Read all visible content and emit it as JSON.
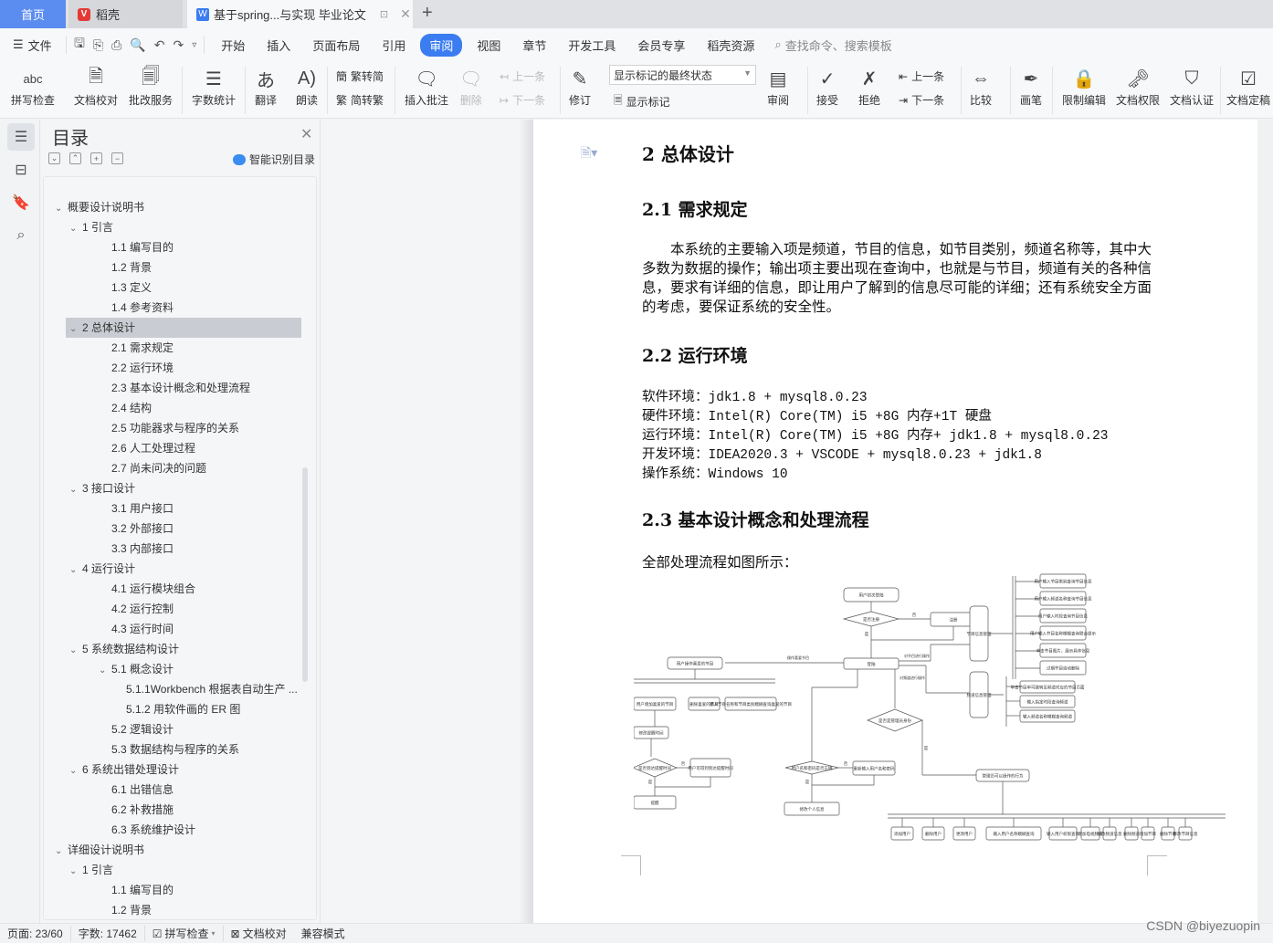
{
  "tabs": {
    "home": "首页",
    "daoke": "稻壳",
    "document": "基于spring...与实现 毕业论文"
  },
  "menubar": {
    "file": "文件",
    "menus": [
      "开始",
      "插入",
      "页面布局",
      "引用",
      "审阅",
      "视图",
      "章节",
      "开发工具",
      "会员专享",
      "稻壳资源"
    ],
    "active_menu": "审阅",
    "search_placeholder": "查找命令、搜索模板"
  },
  "ribbon": {
    "spell_check": "拼写检查",
    "doc_proofread": "文档校对",
    "correction_service": "批改服务",
    "word_count": "字数统计",
    "translate": "翻译",
    "read_aloud": "朗读",
    "trad_to_simp": "繁转简",
    "simp_to_trad": "简转繁",
    "insert_comment": "插入批注",
    "delete": "删除",
    "prev_comment": "上一条",
    "next_comment": "下一条",
    "revise": "修订",
    "markup_state": "显示标记的最终状态",
    "show_markup": "显示标记",
    "review": "审阅",
    "accept": "接受",
    "reject": "拒绝",
    "prev_change": "上一条",
    "next_change": "下一条",
    "compare": "比较",
    "pen": "画笔",
    "restrict_edit": "限制编辑",
    "doc_permission": "文档权限",
    "doc_certify": "文档认证",
    "doc_finalize": "文档定稿"
  },
  "toc": {
    "title": "目录",
    "smart_button": "智能识别目录",
    "items": [
      {
        "label": "概要设计说明书",
        "level": 0,
        "expanded": true
      },
      {
        "label": "1 引言",
        "level": 1,
        "expanded": true
      },
      {
        "label": "1.1 编写目的",
        "level": 2
      },
      {
        "label": "1.2 背景",
        "level": 2
      },
      {
        "label": "1.3 定义",
        "level": 2
      },
      {
        "label": "1.4 参考资料",
        "level": 2
      },
      {
        "label": "2 总体设计",
        "level": 1,
        "expanded": true,
        "selected": true
      },
      {
        "label": "2.1 需求规定",
        "level": 2
      },
      {
        "label": "2.2 运行环境",
        "level": 2
      },
      {
        "label": "2.3 基本设计概念和处理流程",
        "level": 2
      },
      {
        "label": "2.4 结构",
        "level": 2
      },
      {
        "label": "2.5 功能器求与程序的关系",
        "level": 2
      },
      {
        "label": "2.6 人工处理过程",
        "level": 2
      },
      {
        "label": "2.7 尚未问决的问题",
        "level": 2
      },
      {
        "label": "3 接口设计",
        "level": 1,
        "expanded": true
      },
      {
        "label": "3.1 用户接口",
        "level": 2
      },
      {
        "label": "3.2 外部接口",
        "level": 2
      },
      {
        "label": "3.3 内部接口",
        "level": 2
      },
      {
        "label": "4 运行设计",
        "level": 1,
        "expanded": true
      },
      {
        "label": "4.1 运行模块组合",
        "level": 2
      },
      {
        "label": "4.2 运行控制",
        "level": 2
      },
      {
        "label": "4.3 运行时间",
        "level": 2
      },
      {
        "label": "5 系统数据结构设计",
        "level": 1,
        "expanded": true
      },
      {
        "label": "5.1 概念设计",
        "level": 2,
        "expanded": true
      },
      {
        "label": "5.1.1Workbench 根据表自动生产 ...",
        "level": 3
      },
      {
        "label": "5.1.2 用软件画的 ER 图",
        "level": 3
      },
      {
        "label": "5.2 逻辑设计",
        "level": 2
      },
      {
        "label": "5.3 数据结构与程序的关系",
        "level": 2
      },
      {
        "label": "6 系统出错处理设计",
        "level": 1,
        "expanded": true
      },
      {
        "label": "6.1 出错信息",
        "level": 2
      },
      {
        "label": "6.2 补救措施",
        "level": 2
      },
      {
        "label": "6.3 系统维护设计",
        "level": 2
      },
      {
        "label": "详细设计说明书",
        "level": 0,
        "expanded": true
      },
      {
        "label": "1 引言",
        "level": 1,
        "expanded": true
      },
      {
        "label": "1.1 编写目的",
        "level": 2
      },
      {
        "label": "1.2 背景",
        "level": 2
      }
    ]
  },
  "document": {
    "h1": "2 总体设计",
    "h2_1": "2.1 需求规定",
    "para_1": "本系统的主要输入项是频道，节目的信息，如节目类别，频道名称等，其中大多数为数据的操作；输出项主要出现在查询中，也就是与节目，频道有关的各种信息，要求有详细的信息，即让用户了解到的信息尽可能的详细；还有系统安全方面的考虑，要保证系统的安全性。",
    "h2_2": "2.2 运行环境",
    "env": [
      {
        "key": "软件环境：",
        "val": "jdk1.8 + mysql8.0.23"
      },
      {
        "key": "硬件环境：",
        "val": "Intel(R) Core(TM) i5 +8G 内存+1T 硬盘"
      },
      {
        "key": "运行环境：",
        "val": "Intel(R) Core(TM) i5 +8G 内存+ jdk1.8 + mysql8.0.23"
      },
      {
        "key": "开发环境：",
        "val": "IDEA2020.3 + VSCODE + mysql8.0.23 + jdk1.8"
      },
      {
        "key": "操作系统：",
        "val": "Windows 10"
      }
    ],
    "h2_3": "2.3 基本设计概念和处理流程",
    "caption": "全部处理流程如图所示：",
    "flowchart": {
      "nodes": {
        "first_visit": "用户初次登陆",
        "registered_q": "是否注册",
        "register": "注册",
        "login": "登陆",
        "program_mgmt": "节目信息管理",
        "channel_mgmt": "频道信息管理",
        "fav_ops": "用户操作喜爱的节目",
        "admin_q": "是否是管理员身份",
        "pwd_q": "用户名和密码是否正确",
        "reenter": "重新输入用户名和密码",
        "modify_info": "修改个人信息",
        "admin_actions": "管理员可以操作的行为",
        "add_fav": "用户增加喜爱的节目",
        "del_fav": "删除喜爱的节目",
        "search_fav": "输入节目名称和节目类别模糊查询喜爱的节目",
        "modify_remind": "修改提醒时间",
        "remind_q": "是否到达提醒时间",
        "get_remind": "用户可得到到达提醒时间",
        "remind": "提醒"
      },
      "labels": {
        "no": "否",
        "yes": "是",
        "op_fav": "操作喜爱节目",
        "op_program": "对节目进行操作",
        "op_channel": "对频道进行操作"
      },
      "program_actions": [
        "用户输入节目类别查询节目信息",
        "用户输入频道名称查询节目信息",
        "用户输入时段查询节目信息",
        "用户输入节目名称模糊查询联合提示",
        "单击节目图片，展示具体信息",
        "过期节目自动删除"
      ],
      "channel_actions": [
        "单击节目单可跳转至频道对应的节目页面",
        "输入指定时段查询频道",
        "输入频道名称模糊查询频道"
      ],
      "admin_list": [
        "添加用户",
        "删除用户",
        "更改用户",
        "输入用户名称模糊查询",
        "输入用户权限查询",
        "增加电视频道",
        "修改频道信息",
        "删除频道",
        "增加节目",
        "删除节目",
        "修改节目信息"
      ]
    }
  },
  "status": {
    "page": "页面: 23/60",
    "words": "字数: 17462",
    "spell": "拼写检查",
    "proof": "文档校对",
    "compat": "兼容模式"
  },
  "watermark": "CSDN @biyezuopin"
}
